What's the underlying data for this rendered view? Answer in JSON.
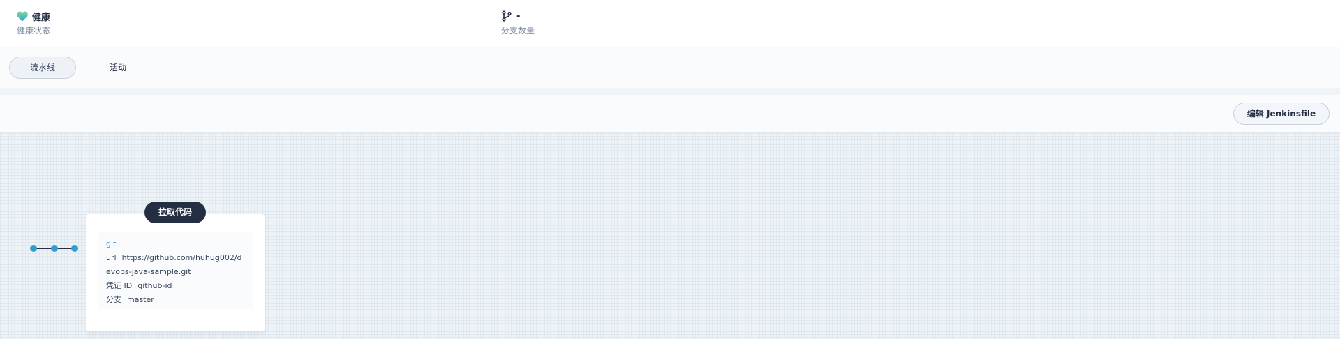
{
  "stats": {
    "health": {
      "value": "健康",
      "label": "健康状态",
      "icon": "heart-icon",
      "color": "#55bc8a"
    },
    "branches": {
      "value": "-",
      "label": "分支数量",
      "icon": "branch-icon"
    }
  },
  "tabs": [
    {
      "label": "流水线",
      "active": true
    },
    {
      "label": "活动",
      "active": false
    }
  ],
  "toolbar": {
    "edit_label": "编辑 Jenkinsfile"
  },
  "pipeline": {
    "stage": {
      "title": "拉取代码",
      "step": {
        "name": "git",
        "params": [
          {
            "key": "url",
            "value": "https://github.com/huhug002/devops-java-sample.git"
          },
          {
            "key": "凭证 ID",
            "value": "github-id"
          },
          {
            "key": "分支",
            "value": "master"
          }
        ]
      }
    },
    "colors": {
      "node": "#329dce",
      "line": "#242e42"
    }
  }
}
